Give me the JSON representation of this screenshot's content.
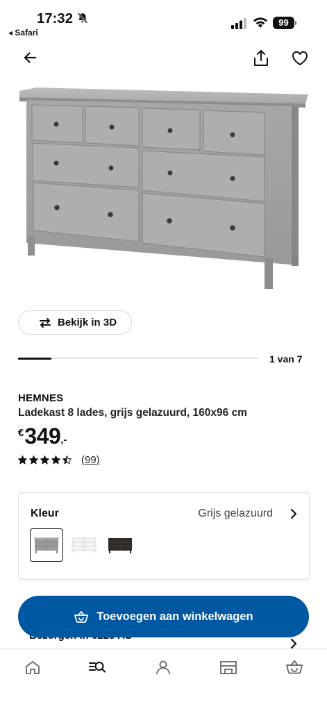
{
  "status_bar": {
    "time": "17:32",
    "back_app": "◂ Safari",
    "battery": "99",
    "icons": [
      "bell-muted-icon",
      "signal-icon",
      "wifi-icon",
      "battery-icon"
    ]
  },
  "header": {
    "icons": [
      "back-arrow-icon",
      "share-icon",
      "heart-icon"
    ]
  },
  "product": {
    "image": "grey-8-drawer-dresser",
    "view_3d_label": "Bekijk in 3D",
    "carousel_position": "1 van 7",
    "carousel_progress": 0.14,
    "brand": "HEMNES",
    "description": "Ladekast 8 lades, grijs gelazuurd, 160x96 cm",
    "price_currency": "€",
    "price_amount": "349",
    "price_suffix": ",-",
    "rating": 4.5,
    "review_count": "(99)"
  },
  "color": {
    "label": "Kleur",
    "selected": "Grijs gelazuurd",
    "options": [
      "grey",
      "white",
      "black-brown"
    ]
  },
  "delivery": {
    "label": "Bezorgen in 6225 AS"
  },
  "actions": {
    "add_to_cart": "Toevoegen aan winkelwagen"
  },
  "bottom_nav": {
    "items": [
      "home-icon",
      "search-icon",
      "profile-icon",
      "store-icon",
      "cart-icon"
    ]
  },
  "colors": {
    "accent": "#0058a3",
    "text": "#111111",
    "border": "#dcdcdc"
  }
}
